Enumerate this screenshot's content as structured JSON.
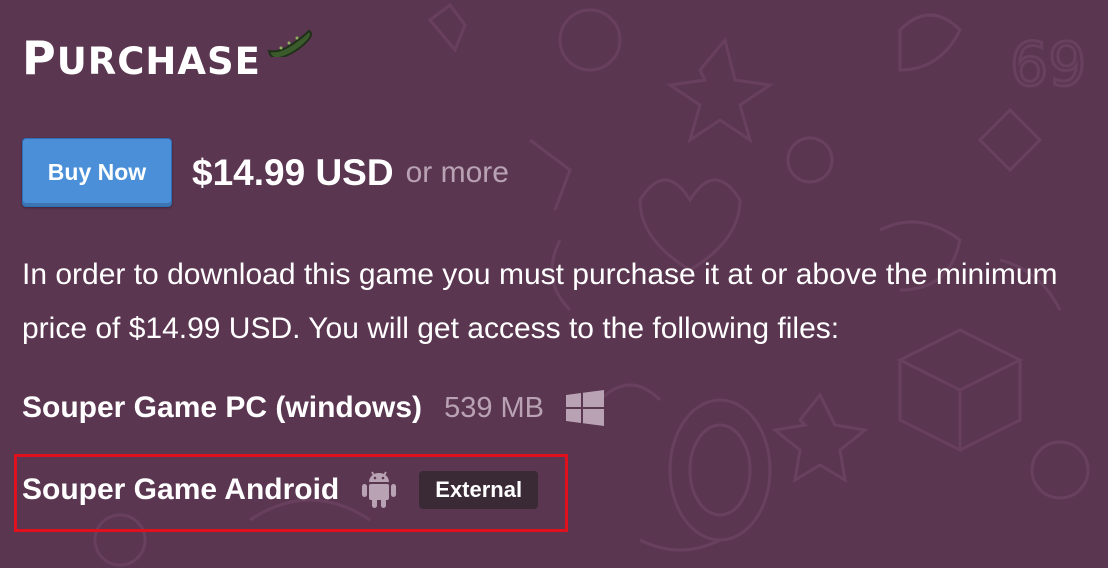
{
  "heading": {
    "title": "Purchase"
  },
  "purchase": {
    "buy_label": "Buy Now",
    "price": "$14.99 USD",
    "or_more": "or more"
  },
  "description": "In order to download this game you must purchase it at or above the minimum price of $14.99 USD. You will get access to the following files:",
  "files": [
    {
      "name": "Souper Game PC (windows)",
      "size": "539 MB",
      "platform_icon": "windows-icon"
    },
    {
      "name": "Souper Game Android",
      "platform_icon": "android-icon",
      "badge": "External"
    }
  ],
  "colors": {
    "background": "#5b3651",
    "button": "#4a8fd8",
    "muted_text": "#b9a2b3",
    "badge_bg": "#3a2a36",
    "highlight": "#e0101c"
  }
}
